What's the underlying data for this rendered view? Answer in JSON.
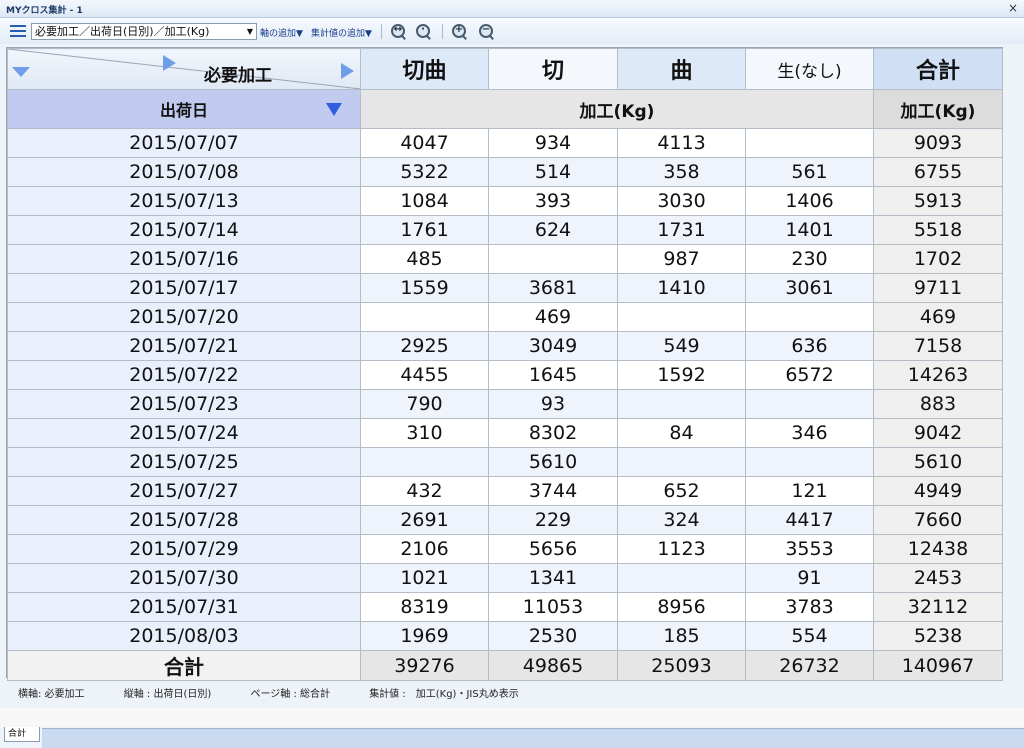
{
  "window": {
    "title": "MYクロス集計 - 1",
    "close_glyph": "×"
  },
  "toolbar": {
    "axis_selector_value": "必要加工／出荷日(日別)／加工(Kg)",
    "axis_selector_arrow": "▼",
    "add_axis_label": "軸の追加▼",
    "add_value_label": "集計値の追加▼"
  },
  "icons": {
    "menu": "hamburger-menu-icon",
    "zoom_fit": "zoom-fit-icon",
    "zoom_reset": "zoom-reset-icon",
    "zoom_in": "zoom-in-icon",
    "zoom_out": "zoom-out-icon"
  },
  "colors": {
    "accent": "#2f5fe0",
    "header_blue": "#dde9f8",
    "row_axis_header": "#c1cbef"
  },
  "pivot": {
    "column_axis_label": "必要加工",
    "columns": [
      "切曲",
      "切",
      "曲",
      "生(なし)"
    ],
    "total_label": "合計",
    "row_axis_label": "出荷日",
    "measure_label": "加工(Kg)",
    "rows": [
      {
        "date": "2015/07/07",
        "values": [
          "4047",
          "934",
          "4113",
          ""
        ],
        "total": "9093"
      },
      {
        "date": "2015/07/08",
        "values": [
          "5322",
          "514",
          "358",
          "561"
        ],
        "total": "6755"
      },
      {
        "date": "2015/07/13",
        "values": [
          "1084",
          "393",
          "3030",
          "1406"
        ],
        "total": "5913"
      },
      {
        "date": "2015/07/14",
        "values": [
          "1761",
          "624",
          "1731",
          "1401"
        ],
        "total": "5518"
      },
      {
        "date": "2015/07/16",
        "values": [
          "485",
          "",
          "987",
          "230"
        ],
        "total": "1702"
      },
      {
        "date": "2015/07/17",
        "values": [
          "1559",
          "3681",
          "1410",
          "3061"
        ],
        "total": "9711"
      },
      {
        "date": "2015/07/20",
        "values": [
          "",
          "469",
          "",
          ""
        ],
        "total": "469"
      },
      {
        "date": "2015/07/21",
        "values": [
          "2925",
          "3049",
          "549",
          "636"
        ],
        "total": "7158"
      },
      {
        "date": "2015/07/22",
        "values": [
          "4455",
          "1645",
          "1592",
          "6572"
        ],
        "total": "14263"
      },
      {
        "date": "2015/07/23",
        "values": [
          "790",
          "93",
          "",
          ""
        ],
        "total": "883"
      },
      {
        "date": "2015/07/24",
        "values": [
          "310",
          "8302",
          "84",
          "346"
        ],
        "total": "9042"
      },
      {
        "date": "2015/07/25",
        "values": [
          "",
          "5610",
          "",
          ""
        ],
        "total": "5610"
      },
      {
        "date": "2015/07/27",
        "values": [
          "432",
          "3744",
          "652",
          "121"
        ],
        "total": "4949"
      },
      {
        "date": "2015/07/28",
        "values": [
          "2691",
          "229",
          "324",
          "4417"
        ],
        "total": "7660"
      },
      {
        "date": "2015/07/29",
        "values": [
          "2106",
          "5656",
          "1123",
          "3553"
        ],
        "total": "12438"
      },
      {
        "date": "2015/07/30",
        "values": [
          "1021",
          "1341",
          "",
          "91"
        ],
        "total": "2453"
      },
      {
        "date": "2015/07/31",
        "values": [
          "8319",
          "11053",
          "8956",
          "3783"
        ],
        "total": "32112"
      },
      {
        "date": "2015/08/03",
        "values": [
          "1969",
          "2530",
          "185",
          "554"
        ],
        "total": "5238"
      }
    ],
    "grand_total_label": "合計",
    "column_totals": [
      "39276",
      "49865",
      "25093",
      "26732"
    ],
    "grand_total": "140967"
  },
  "footer": {
    "horizontal_axis": "横軸: 必要加工",
    "vertical_axis": "縦軸 : 出荷日(日別)",
    "page_axis": "ページ軸 : 総合計",
    "aggregate_value": "集計値 :　加工(Kg)・JIS丸め表示"
  },
  "sheet_tab": {
    "label": "合計"
  }
}
